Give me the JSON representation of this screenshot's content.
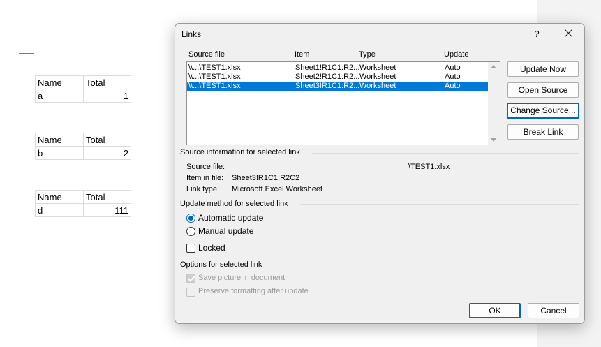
{
  "document": {
    "tables": [
      {
        "h1": "Name",
        "h2": "Total",
        "c1": "a",
        "c2": "1"
      },
      {
        "h1": "Name",
        "h2": "Total",
        "c1": "b",
        "c2": "2"
      },
      {
        "h1": "Name",
        "h2": "Total",
        "c1": "d",
        "c2": "111"
      }
    ]
  },
  "dialog": {
    "title": "Links",
    "help": "?",
    "columns": {
      "source": "Source file",
      "item": "Item",
      "type": "Type",
      "update": "Update"
    },
    "links": [
      {
        "source": "\\\\...\\TEST1.xlsx",
        "item": "Sheet1!R1C1:R2...",
        "type": "Worksheet",
        "update": "Auto"
      },
      {
        "source": "\\\\...\\TEST1.xlsx",
        "item": "Sheet2!R1C1:R2...",
        "type": "Worksheet",
        "update": "Auto"
      },
      {
        "source": "\\\\...\\TEST1.xlsx",
        "item": "Sheet3!R1C1:R2...",
        "type": "Worksheet",
        "update": "Auto"
      }
    ],
    "buttons": {
      "update_now": "Update Now",
      "open_source": "Open Source",
      "change_source": "Change Source...",
      "break_link": "Break Link",
      "ok": "OK",
      "cancel": "Cancel"
    },
    "source_info": {
      "group": "Source information for selected link",
      "source_file_label": "Source file:",
      "source_file_value": "\\TEST1.xlsx",
      "item_label": "Item in file:",
      "item_value": "Sheet3!R1C1:R2C2",
      "type_label": "Link type:",
      "type_value": "Microsoft Excel Worksheet"
    },
    "update_method": {
      "group": "Update method for selected link",
      "automatic": "Automatic update",
      "manual": "Manual update",
      "locked": "Locked"
    },
    "options": {
      "group": "Options for selected link",
      "save_picture": "Save picture in document",
      "preserve_formatting": "Preserve formatting after update"
    },
    "colors": {
      "selection": "#0078d7",
      "focus": "#0067c0"
    }
  }
}
